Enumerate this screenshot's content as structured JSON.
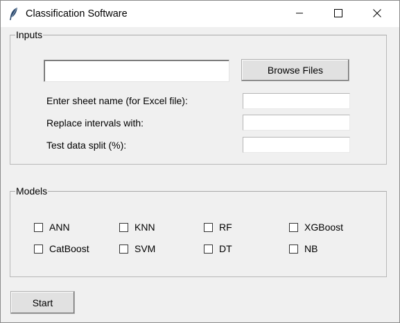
{
  "window": {
    "title": "Classification Software",
    "icon": "feather-icon",
    "controls": [
      "minimize-icon",
      "maximize-icon",
      "close-icon"
    ]
  },
  "inputs": {
    "group_label": "Inputs",
    "file_path_value": "",
    "browse_label": "Browse Files",
    "fields": [
      {
        "label": "Enter sheet name (for Excel file):",
        "value": ""
      },
      {
        "label": "Replace intervals with:",
        "value": ""
      },
      {
        "label": "Test data split (%):",
        "value": ""
      }
    ]
  },
  "models": {
    "group_label": "Models",
    "items": [
      {
        "label": "ANN",
        "checked": false
      },
      {
        "label": "KNN",
        "checked": false
      },
      {
        "label": "RF",
        "checked": false
      },
      {
        "label": "XGBoost",
        "checked": false
      },
      {
        "label": "CatBoost",
        "checked": false
      },
      {
        "label": "SVM",
        "checked": false
      },
      {
        "label": "DT",
        "checked": false
      },
      {
        "label": "NB",
        "checked": false
      }
    ]
  },
  "actions": {
    "start_label": "Start"
  }
}
